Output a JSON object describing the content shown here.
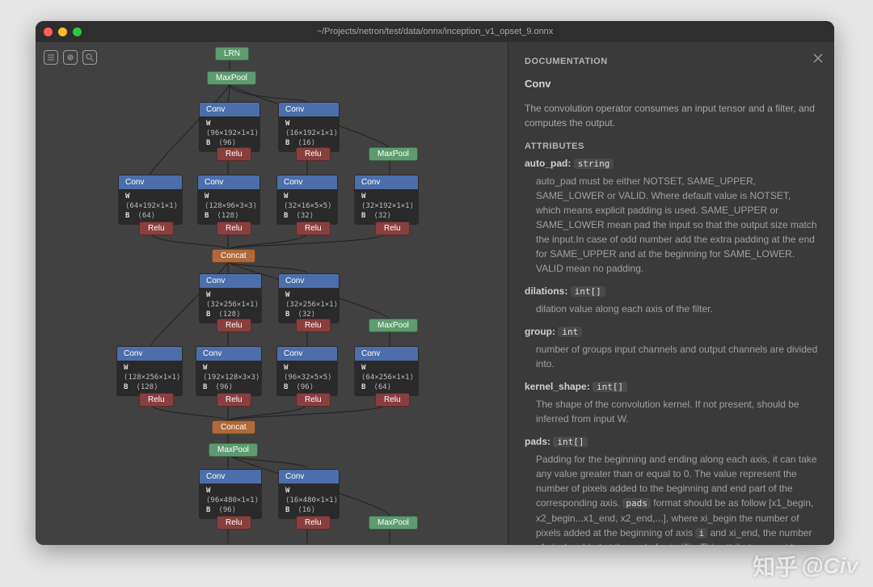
{
  "window": {
    "title": "~/Projects/netron/test/data/onnx/inception_v1_opset_9.onnx"
  },
  "toolbar": {
    "menu_name": "menu-icon",
    "fit_name": "fit-icon",
    "search_name": "search-icon"
  },
  "graph": {
    "lrn": "LRN",
    "maxpool": "MaxPool",
    "relu": "Relu",
    "concat": "Concat",
    "conv_label": "Conv",
    "w_label": "W",
    "b_label": "B",
    "convs": {
      "r1a": {
        "w": "⟨96×192×1×1⟩",
        "b": "⟨96⟩"
      },
      "r1b": {
        "w": "⟨16×192×1×1⟩",
        "b": "⟨16⟩"
      },
      "r2a": {
        "w": "⟨64×192×1×1⟩",
        "b": "⟨64⟩"
      },
      "r2b": {
        "w": "⟨128×96×3×3⟩",
        "b": "⟨128⟩"
      },
      "r2c": {
        "w": "⟨32×16×5×5⟩",
        "b": "⟨32⟩"
      },
      "r2d": {
        "w": "⟨32×192×1×1⟩",
        "b": "⟨32⟩"
      },
      "r3a": {
        "w": "⟨32×256×1×1⟩",
        "b": "⟨128⟩"
      },
      "r3b": {
        "w": "⟨32×256×1×1⟩",
        "b": "⟨32⟩"
      },
      "r4a": {
        "w": "⟨128×256×1×1⟩",
        "b": "⟨128⟩"
      },
      "r4b": {
        "w": "⟨192×128×3×3⟩",
        "b": "⟨96⟩"
      },
      "r4c": {
        "w": "⟨96×32×5×5⟩",
        "b": "⟨96⟩"
      },
      "r4d": {
        "w": "⟨64×256×1×1⟩",
        "b": "⟨64⟩"
      },
      "r5a": {
        "w": "⟨96×480×1×1⟩",
        "b": "⟨96⟩"
      },
      "r5b": {
        "w": "⟨16×480×1×1⟩",
        "b": "⟨16⟩"
      }
    }
  },
  "doc": {
    "heading": "DOCUMENTATION",
    "op": "Conv",
    "summary": "The convolution operator consumes an input tensor and a filter, and computes the output.",
    "attrs_heading": "ATTRIBUTES",
    "attrs": {
      "auto_pad": {
        "name": "auto_pad:",
        "type": "string",
        "desc": "auto_pad must be either NOTSET, SAME_UPPER, SAME_LOWER or VALID. Where default value is NOTSET, which means explicit padding is used. SAME_UPPER or SAME_LOWER mean pad the input so that the output size match the input.In case of odd number add the extra padding at the end for SAME_UPPER and at the beginning for SAME_LOWER. VALID mean no padding."
      },
      "dilations": {
        "name": "dilations:",
        "type": "int[]",
        "desc": "dilation value along each axis of the filter."
      },
      "group": {
        "name": "group:",
        "type": "int",
        "desc": "number of groups input channels and output channels are divided into."
      },
      "kernel_shape": {
        "name": "kernel_shape:",
        "type": "int[]",
        "desc": "The shape of the convolution kernel. If not present, should be inferred from input W."
      },
      "pads": {
        "name": "pads:",
        "type": "int[]",
        "desc_pre": "Padding for the beginning and ending along each axis, it can take any value greater than or equal to 0. The value represent the number of pixels added to the beginning and end part of the corresponding axis. ",
        "code1": "pads",
        "desc_mid1": " format should be as follow [x1_begin, x2_begin...x1_end, x2_end,...], where xi_begin the number of pixels added at the beginning of axis ",
        "code2": "i",
        "desc_mid2": " and xi_end, the number of pixels added at the end of axis ",
        "code3": "i",
        "desc_post": " . This attribute cannot be used simultaneously with auto_pad attribute. If not present, the padding defaults to 0 along start and end of each axis."
      }
    }
  },
  "watermark": {
    "site": "知乎",
    "user": "@Civ"
  }
}
